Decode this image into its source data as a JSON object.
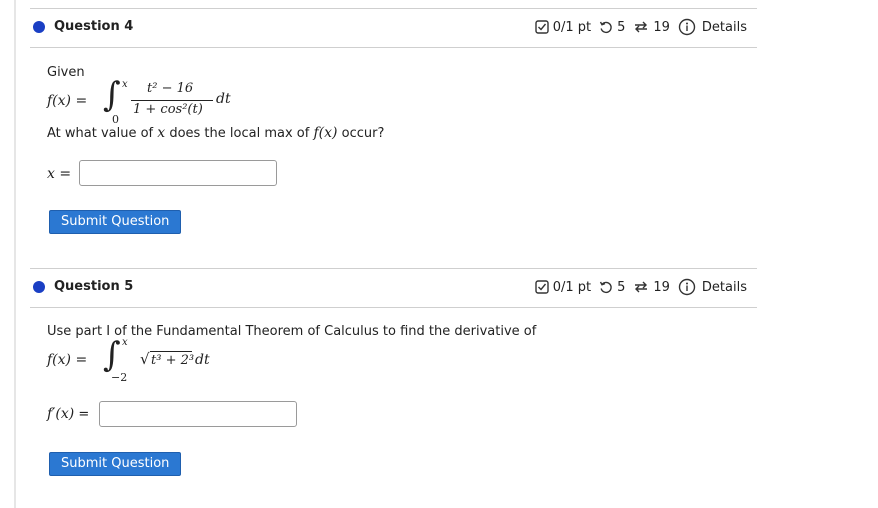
{
  "questions": [
    {
      "title": "Question 4",
      "score": "0/1 pt",
      "attempts": "5",
      "resubmits": "19",
      "details_label": "Details",
      "given_label": "Given",
      "f_lhs": "f(x) =",
      "integral_upper": "x",
      "integral_lower": "0",
      "numerator": "t² − 16",
      "denominator": "1 + cos²(t)",
      "differential": "dt",
      "prompt_pre": "At what value of",
      "prompt_var": "x",
      "prompt_mid": "does the local max of",
      "prompt_func": "f(x)",
      "prompt_post": "occur?",
      "answer_label": "x =",
      "answer_value": "",
      "submit_label": "Submit Question"
    },
    {
      "title": "Question 5",
      "score": "0/1 pt",
      "attempts": "5",
      "resubmits": "19",
      "details_label": "Details",
      "prompt": "Use part I of the Fundamental Theorem of Calculus to find the derivative of",
      "f_lhs": "f(x) =",
      "integral_upper": "x",
      "integral_lower": "−2",
      "integrand": "t³ + 2³",
      "differential": "dt",
      "answer_label_func": "f′(x)",
      "answer_label_eq": "=",
      "answer_value": "",
      "submit_label": "Submit Question"
    }
  ],
  "icons": {
    "score": "checkbox-icon",
    "attempts": "retry-icon",
    "resubmits": "repeat-icon",
    "details": "info-icon"
  },
  "colors": {
    "dot": "#1a3fc4",
    "button": "#2b78d2"
  }
}
